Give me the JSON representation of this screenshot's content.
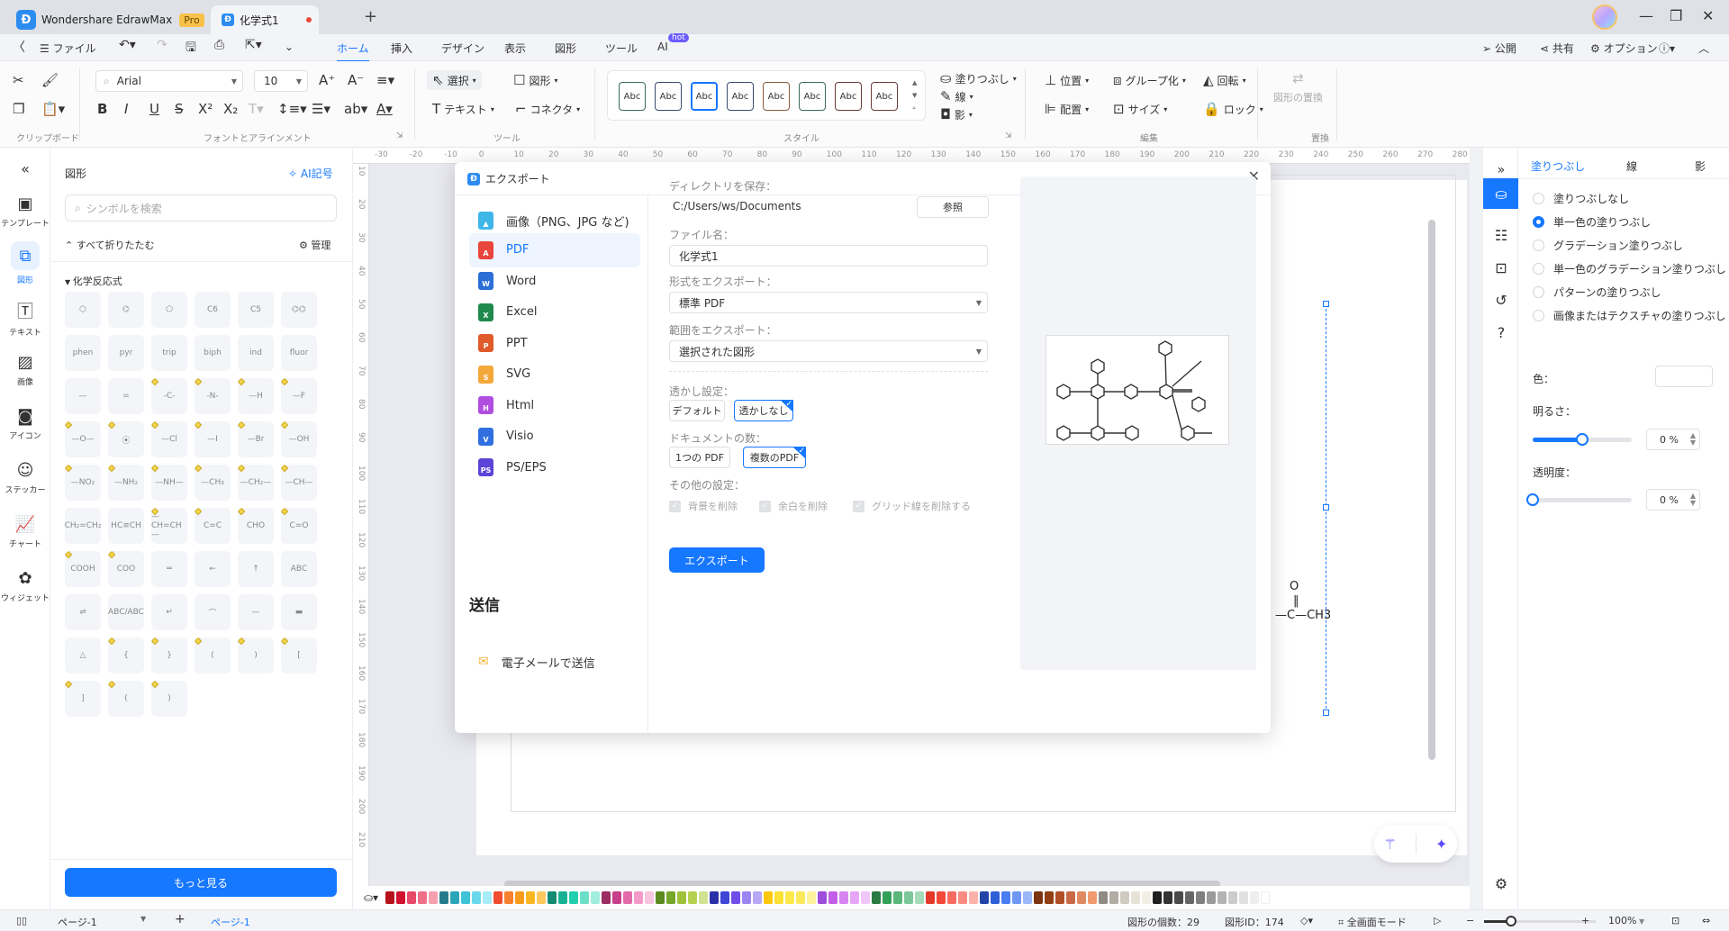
{
  "titlebar": {
    "app_name": "Wondershare EdrawMax",
    "badge": "Pro",
    "doc_tab": "化学式1",
    "new_tab": "+",
    "controls": {
      "minimize": "—",
      "maximize": "❐",
      "close": "✕"
    }
  },
  "menubar": {
    "back": "〈",
    "file": "ファイル",
    "tabs": [
      "ホーム",
      "挿入",
      "デザイン",
      "表示",
      "図形",
      "ツール",
      "AI"
    ],
    "active_tab": "ホーム",
    "ai_badge": "hot",
    "right": {
      "publish": "公開",
      "share": "共有",
      "options": "オプション"
    }
  },
  "ribbon": {
    "clipboard_label": "クリップボード",
    "font_name": "Arial",
    "font_size": "10",
    "font_group_label": "フォントとアラインメント",
    "tools": {
      "select": "選択",
      "shape": "図形",
      "text": "テキスト",
      "connector": "コネクタ",
      "label": "ツール"
    },
    "style_samples": [
      "Abc",
      "Abc",
      "Abc",
      "Abc",
      "Abc",
      "Abc",
      "Abc",
      "Abc"
    ],
    "style_label": "スタイル",
    "fill": "塗りつぶし",
    "line": "線",
    "shadow": "影",
    "edit": {
      "position": "位置",
      "group": "グループ化",
      "rotate": "回転",
      "align": "配置",
      "size": "サイズ",
      "lock": "ロック",
      "label": "編集"
    },
    "replace": {
      "button": "図形の置換",
      "label": "置換"
    }
  },
  "leftrail": [
    {
      "label": "テンプレート",
      "icon": "template-icon"
    },
    {
      "label": "図形",
      "icon": "shapes-icon",
      "active": true
    },
    {
      "label": "テキスト",
      "icon": "text-icon"
    },
    {
      "label": "画像",
      "icon": "image-icon"
    },
    {
      "label": "アイコン",
      "icon": "icon-icon"
    },
    {
      "label": "ステッカー",
      "icon": "sticker-icon"
    },
    {
      "label": "チャート",
      "icon": "chart-icon"
    },
    {
      "label": "ウィジェット",
      "icon": "widget-icon"
    }
  ],
  "leftpanel": {
    "title": "図形",
    "ai_symbol": "AI記号",
    "search_placeholder": "シンボルを検索",
    "collapse_all": "すべて折りたたむ",
    "manage": "管理",
    "category": "化学反応式",
    "shapes": [
      "⬡",
      "⌬",
      "⬠",
      "C6",
      "C5",
      "⌬⌬",
      "phen",
      "pyr",
      "trip",
      "biph",
      "ind",
      "fluor",
      "—",
      "=",
      "-C-",
      "-N-",
      "—H",
      "—F",
      "—O—",
      "⦿",
      "—Cl",
      "—I",
      "—Br",
      "—OH",
      "—NO₂",
      "—NH₂",
      "—NH—",
      "—CH₃",
      "—CH₂—",
      "—CH—",
      "CH₂=CH₂",
      "HC≡CH",
      "—CH=CH—",
      "C=C",
      "CHO",
      "C=O",
      "COOH",
      "COO",
      "═",
      "←",
      "↑",
      "ABC",
      "⇌",
      "ABC/ABC",
      "↵",
      "⌒",
      "—",
      "▬",
      "△",
      "{",
      "}",
      "(",
      ")",
      "[",
      "]",
      "(",
      ")"
    ],
    "more_button": "もっと見る"
  },
  "canvas": {
    "ruler_h": [
      "-30",
      "-20",
      "-10",
      "0",
      "10",
      "20",
      "30",
      "40",
      "50",
      "60",
      "70",
      "80",
      "90",
      "100",
      "110",
      "120",
      "130",
      "140",
      "150",
      "160",
      "170",
      "180",
      "190",
      "200",
      "210",
      "220",
      "230",
      "240",
      "250",
      "260",
      "270",
      "280"
    ],
    "ruler_v": [
      "10",
      "20",
      "30",
      "40",
      "50",
      "60",
      "70",
      "80",
      "90",
      "100",
      "110",
      "120",
      "130",
      "140",
      "150",
      "160",
      "170",
      "180",
      "190",
      "200",
      "210"
    ],
    "formula_fragment_top": "O",
    "formula_fragment": "—C—CH3"
  },
  "palette": [
    "#b5121b",
    "#d0122f",
    "#e8486a",
    "#f06f88",
    "#f7a1b0",
    "#237c8c",
    "#2aa5b8",
    "#3ec2d8",
    "#6ad8ec",
    "#a6ecf7",
    "#f24d2f",
    "#f7812e",
    "#f99b1c",
    "#fbb622",
    "#fdc85e",
    "#148a72",
    "#17b294",
    "#21cfae",
    "#6cdfc8",
    "#a2eddd",
    "#9b2c64",
    "#c7408a",
    "#e36aaa",
    "#f49ac9",
    "#f7c5de",
    "#5c8a1e",
    "#76a62a",
    "#9dc23a",
    "#b6d14f",
    "#d1e292",
    "#2a2fa8",
    "#3d46d6",
    "#6e4de8",
    "#9b86f2",
    "#b6a8f6",
    "#fdc80c",
    "#fde034",
    "#fde94a",
    "#fbe85b",
    "#fef29a",
    "#9d4ddb",
    "#c35ee8",
    "#d684f0",
    "#e6a6f5",
    "#efc6f8",
    "#2a7a44",
    "#33a05a",
    "#5ab779",
    "#7cc799",
    "#a5dbb9",
    "#e33a2c",
    "#f24a3a",
    "#f86b60",
    "#fa8b83",
    "#fcb2ab",
    "#2345a8",
    "#2f5fd6",
    "#4a7df0",
    "#6f98f5",
    "#9bb8f8",
    "#7a3410",
    "#913e12",
    "#b04e26",
    "#c96a47",
    "#e08a64",
    "#f09a6e",
    "#8e8a86",
    "#b2ada4",
    "#cfcbc0",
    "#e6e2d6",
    "#f2f0e6",
    "#1f1f1f",
    "#333333",
    "#4a4a4a",
    "#666666",
    "#808080",
    "#9a9a9a",
    "#b3b3b3",
    "#cccccc",
    "#e0e0e0",
    "#eeeeee",
    "#ffffff"
  ],
  "rightrail": [
    "fill-icon",
    "list-icon",
    "present-icon",
    "history-icon",
    "help-icon"
  ],
  "rightpanel": {
    "tabs": [
      "塗りつぶし",
      "線",
      "影"
    ],
    "active_tab": "塗りつぶし",
    "fill_options": [
      "塗りつぶしなし",
      "単一色の塗りつぶし",
      "グラデーション塗りつぶし",
      "単一色のグラデーション塗りつぶし",
      "パターンの塗りつぶし",
      "画像またはテクスチャの塗りつぶし"
    ],
    "selected_fill": "単一色の塗りつぶし",
    "color_label": "色：",
    "brightness_label": "明るさ：",
    "brightness_value": "0 %",
    "brightness_slider_fraction": 0.5,
    "transparency_label": "透明度：",
    "transparency_value": "0 %",
    "transparency_slider_fraction": 0.0
  },
  "statusbar": {
    "page_select": "ページ-1",
    "add_page": "+",
    "page_tab": "ページ-1",
    "shape_count": "図形の個数：29",
    "shape_id": "図形ID：174",
    "fullscreen": "全画面モード",
    "zoom": "100%",
    "zoom_minus": "−",
    "zoom_plus": "+"
  },
  "dialog": {
    "title": "エクスポート",
    "close": "✕",
    "formats": [
      {
        "label": "画像（PNG、JPG など)",
        "icon": "image-file-icon",
        "color": "#3fb6e8",
        "glyph": "▲"
      },
      {
        "label": "PDF",
        "icon": "pdf-file-icon",
        "color": "#e8453c",
        "glyph": "A",
        "active": true
      },
      {
        "label": "Word",
        "icon": "word-file-icon",
        "color": "#2b6fd6",
        "glyph": "W"
      },
      {
        "label": "Excel",
        "icon": "excel-file-icon",
        "color": "#1f8a4c",
        "glyph": "X"
      },
      {
        "label": "PPT",
        "icon": "ppt-file-icon",
        "color": "#e05a2b",
        "glyph": "P"
      },
      {
        "label": "SVG",
        "icon": "svg-file-icon",
        "color": "#f3a93a",
        "glyph": "S"
      },
      {
        "label": "Html",
        "icon": "html-file-icon",
        "color": "#b04ee0",
        "glyph": "H"
      },
      {
        "label": "Visio",
        "icon": "visio-file-icon",
        "color": "#2f6fe0",
        "glyph": "V"
      },
      {
        "label": "PS/EPS",
        "icon": "ps-file-icon",
        "color": "#5b45d8",
        "glyph": "PS"
      }
    ],
    "send_heading": "送信",
    "email": "電子メールで送信",
    "dir_label": "ディレクトリを保存：",
    "dir_value": "C:/Users/ws/Documents",
    "browse": "参照",
    "filename_label": "ファイル名：",
    "filename_value": "化学式1",
    "format_label": "形式をエクスポート：",
    "format_value": "標準 PDF",
    "range_label": "範囲をエクスポート：",
    "range_value": "選択された図形",
    "watermark_label": "透かし設定：",
    "watermark_options": [
      "デフォルト",
      "透かしなし"
    ],
    "watermark_selected": "透かしなし",
    "doccount_label": "ドキュメントの数：",
    "doccount_options": [
      "1つの PDF",
      "複数のPDF"
    ],
    "doccount_selected": "複数のPDF",
    "other_label": "その他の設定：",
    "other_checks": [
      "背景を削除",
      "余白を削除",
      "グリッド線を削除する"
    ],
    "export_button": "エクスポート"
  }
}
